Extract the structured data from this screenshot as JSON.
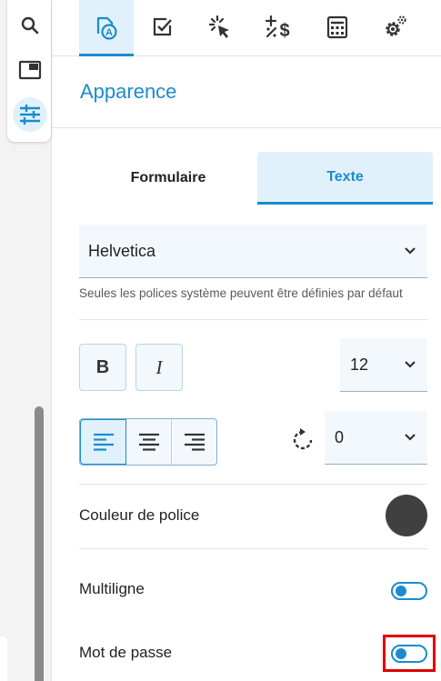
{
  "rail": {
    "items": [
      {
        "icon": "search-icon"
      },
      {
        "icon": "panel-icon"
      },
      {
        "icon": "sliders-icon",
        "active": true
      }
    ]
  },
  "top_tabs": [
    {
      "icon": "appearance-icon",
      "active": true
    },
    {
      "icon": "checkbox-icon"
    },
    {
      "icon": "click-icon"
    },
    {
      "icon": "calculation-icon"
    },
    {
      "icon": "calculator-icon"
    },
    {
      "icon": "settings-gear-icon"
    }
  ],
  "section": {
    "title": "Apparence"
  },
  "sub_tabs": {
    "form": "Formulaire",
    "text": "Texte",
    "active": "text"
  },
  "font": {
    "selected": "Helvetica",
    "hint": "Seules les polices système peuvent être définies par défaut"
  },
  "format": {
    "bold": "B",
    "italic": "I"
  },
  "font_size": {
    "selected": "12"
  },
  "alignment": {
    "selected": "left"
  },
  "rotation": {
    "selected": "0"
  },
  "font_color": {
    "label": "Couleur de police",
    "color": "#404040"
  },
  "multiline": {
    "label": "Multiligne",
    "on": true
  },
  "password": {
    "label": "Mot de passe",
    "on": true
  },
  "colors": {
    "accent": "#1a8ccd",
    "accent_light": "#e1f1fb",
    "highlight": "#e00000"
  }
}
